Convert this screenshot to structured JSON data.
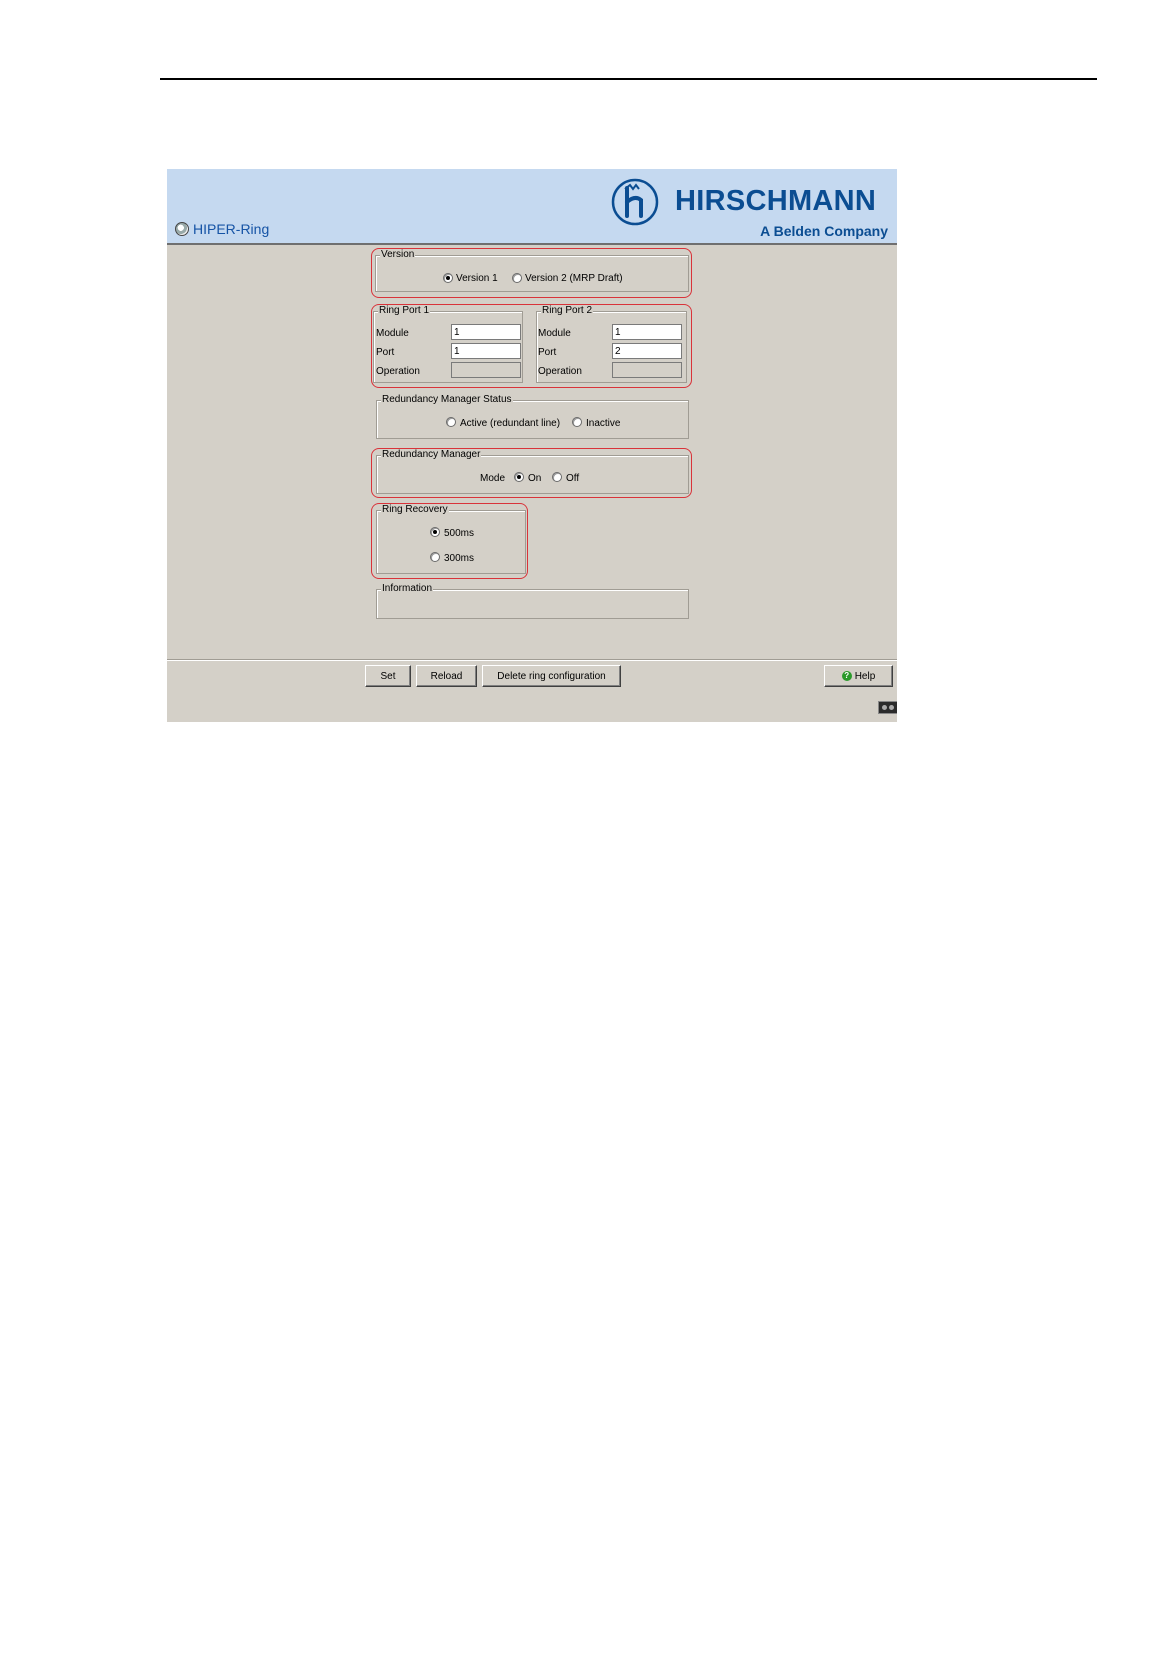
{
  "header": {
    "page_title": "HIPER-Ring",
    "brand_name": "HIRSCHMANN",
    "brand_tagline": "A Belden Company",
    "brand_color": "#0b4d92"
  },
  "version": {
    "legend": "Version",
    "options": [
      {
        "label": "Version 1",
        "selected": true
      },
      {
        "label": "Version 2 (MRP Draft)",
        "selected": false
      }
    ]
  },
  "ring_port_1": {
    "legend": "Ring Port 1",
    "module_label": "Module",
    "module_value": "1",
    "port_label": "Port",
    "port_value": "1",
    "operation_label": "Operation",
    "operation_value": ""
  },
  "ring_port_2": {
    "legend": "Ring Port 2",
    "module_label": "Module",
    "module_value": "1",
    "port_label": "Port",
    "port_value": "2",
    "operation_label": "Operation",
    "operation_value": ""
  },
  "rm_status": {
    "legend": "Redundancy Manager Status",
    "options": [
      {
        "label": "Active (redundant line)",
        "selected": false
      },
      {
        "label": "Inactive",
        "selected": false
      }
    ]
  },
  "rm": {
    "legend": "Redundancy Manager",
    "mode_label": "Mode",
    "options": [
      {
        "label": "On",
        "selected": true
      },
      {
        "label": "Off",
        "selected": false
      }
    ]
  },
  "recovery": {
    "legend": "Ring Recovery",
    "options": [
      {
        "label": "500ms",
        "selected": true
      },
      {
        "label": "300ms",
        "selected": false
      }
    ]
  },
  "information": {
    "legend": "Information",
    "text": ""
  },
  "footer": {
    "set_label": "Set",
    "reload_label": "Reload",
    "delete_label": "Delete ring configuration",
    "help_label": "Help"
  },
  "highlight_color": "#d9333a"
}
